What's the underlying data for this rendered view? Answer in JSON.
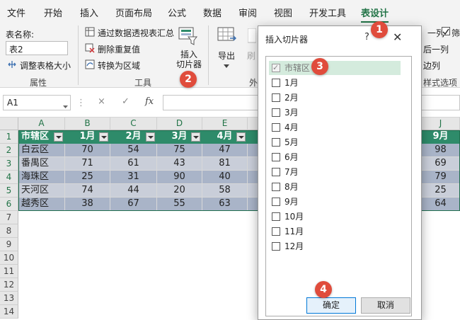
{
  "menu": {
    "tabs": [
      "文件",
      "开始",
      "插入",
      "页面布局",
      "公式",
      "数据",
      "审阅",
      "视图",
      "开发工具",
      "表设计"
    ],
    "active_tab": "表设计"
  },
  "ribbon": {
    "table_name_label": "表名称:",
    "table_name_value": "表2",
    "resize_table": "调整表格大小",
    "group_properties": "属性",
    "summarize_pivot": "通过数据透视表汇总",
    "remove_duplicates": "删除重复值",
    "convert_range": "转换为区域",
    "group_tools": "工具",
    "insert_slicer_line1": "插入",
    "insert_slicer_line2": "切片器",
    "export": "导出",
    "refresh_partial": "刷",
    "group_external_partial": "外",
    "opt_first_col_partial": "一列",
    "opt_filter_partial": "筛",
    "opt_last_col_partial": "后一列",
    "opt_banded_partial": "边列",
    "group_style_options_partial": "样式选项"
  },
  "formula_bar": {
    "name_box": "A1",
    "cancel_icon": "×",
    "confirm_icon": "✓",
    "fx": "fx",
    "value": ""
  },
  "sheet": {
    "columns": [
      "A",
      "B",
      "C",
      "D",
      "E",
      "J"
    ],
    "rows": [
      "1",
      "2",
      "3",
      "4",
      "5",
      "6",
      "7",
      "8",
      "9",
      "10",
      "11",
      "12",
      "13",
      "14"
    ],
    "header": [
      "市辖区",
      "1月",
      "2月",
      "3月",
      "4月",
      "9月"
    ],
    "data": [
      [
        "白云区",
        "70",
        "54",
        "75",
        "47",
        "98"
      ],
      [
        "番禺区",
        "71",
        "61",
        "43",
        "81",
        "69"
      ],
      [
        "海珠区",
        "25",
        "31",
        "90",
        "40",
        "79"
      ],
      [
        "天河区",
        "74",
        "44",
        "20",
        "58",
        "25"
      ],
      [
        "越秀区",
        "38",
        "67",
        "55",
        "63",
        "64"
      ]
    ]
  },
  "dialog": {
    "title": "插入切片器",
    "help": "?",
    "close": "✕",
    "items": [
      {
        "label": "市辖区",
        "checked": true
      },
      {
        "label": "1月",
        "checked": false
      },
      {
        "label": "2月",
        "checked": false
      },
      {
        "label": "3月",
        "checked": false
      },
      {
        "label": "4月",
        "checked": false
      },
      {
        "label": "5月",
        "checked": false
      },
      {
        "label": "6月",
        "checked": false
      },
      {
        "label": "7月",
        "checked": false
      },
      {
        "label": "8月",
        "checked": false
      },
      {
        "label": "9月",
        "checked": false
      },
      {
        "label": "10月",
        "checked": false
      },
      {
        "label": "11月",
        "checked": false
      },
      {
        "label": "12月",
        "checked": false
      }
    ],
    "ok": "确定",
    "cancel": "取消"
  },
  "markers": [
    "1",
    "2",
    "3",
    "4"
  ],
  "colors": {
    "accent": "#217346",
    "table_header": "#2e8b6a",
    "band_dark": "#a9b4c8",
    "band_light": "#c9ced9",
    "marker": "#e04c3c"
  }
}
